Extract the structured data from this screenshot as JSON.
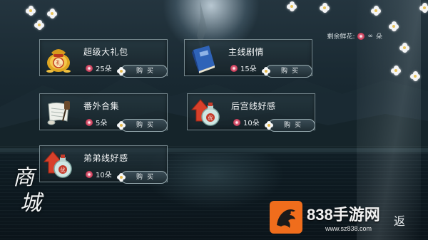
{
  "remaining": {
    "label": "剩余鲜花:",
    "value": "∞",
    "unit": "朵"
  },
  "items": [
    {
      "title": "超级大礼包",
      "price": "25朵",
      "buy_label": "购买",
      "icon": "gift-bag-icon"
    },
    {
      "title": "主线剧情",
      "price": "15朵",
      "buy_label": "购买",
      "icon": "blue-book-icon"
    },
    {
      "title": "番外合集",
      "price": "5朵",
      "buy_label": "购买",
      "icon": "scroll-icon"
    },
    {
      "title": "后宫线好感",
      "price": "10朵",
      "buy_label": "购买",
      "icon": "favor-potion-icon"
    },
    {
      "title": "弟弟线好感",
      "price": "10朵",
      "buy_label": "购买",
      "icon": "favor-potion-icon"
    }
  ],
  "shop_title": [
    "商",
    "城"
  ],
  "watermark": {
    "name": "838手游网",
    "url": "www.sz838.com"
  },
  "back_label": "返",
  "colors": {
    "accent_orange": "#f06d1c",
    "flower_red": "#c2334f",
    "card_border": "#bed2d7"
  }
}
